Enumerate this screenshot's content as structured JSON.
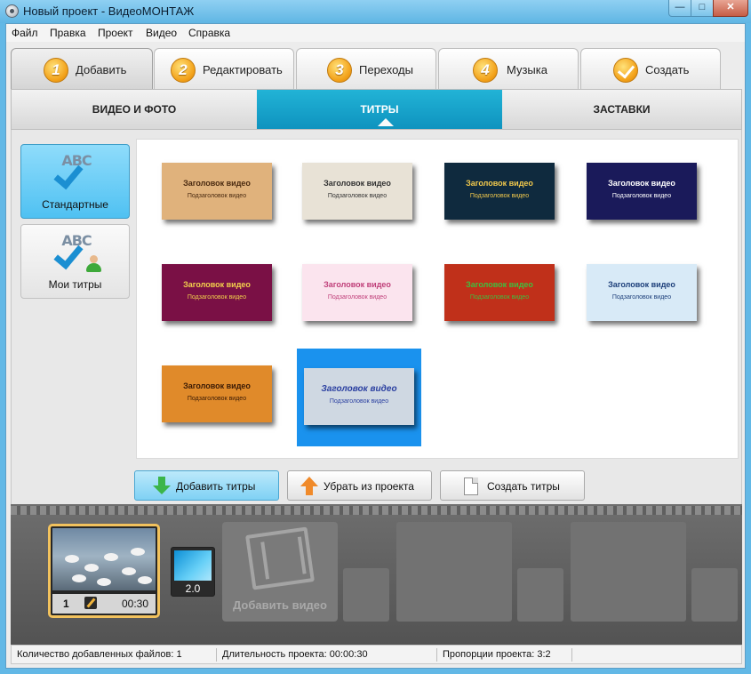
{
  "window": {
    "title": "Новый проект - ВидеоМОНТАЖ"
  },
  "menu": [
    "Файл",
    "Правка",
    "Проект",
    "Видео",
    "Справка"
  ],
  "tabs": [
    {
      "num": "1",
      "label": "Добавить"
    },
    {
      "num": "2",
      "label": "Редактировать"
    },
    {
      "num": "3",
      "label": "Переходы"
    },
    {
      "num": "4",
      "label": "Музыка"
    },
    {
      "num": "",
      "label": "Создать"
    }
  ],
  "subtabs": [
    "ВИДЕО И ФОТО",
    "ТИТРЫ",
    "ЗАСТАВКИ"
  ],
  "categories": [
    {
      "icon_text": "ABC",
      "label": "Стандартные"
    },
    {
      "icon_text": "ABC",
      "label": "Мои титры"
    }
  ],
  "thumbnails": [
    {
      "title": "Заголовок видео",
      "subtitle": "Подзаголовок видео",
      "bg": "#e0b27c",
      "color": "#4a2a10"
    },
    {
      "title": "Заголовок видео",
      "subtitle": "Подзаголовок видео",
      "bg": "#e8e2d6",
      "color": "#333333"
    },
    {
      "title": "Заголовок видео",
      "subtitle": "Подзаголовок видео",
      "bg": "#0f2a3e",
      "color": "#f2c94c"
    },
    {
      "title": "Заголовок видео",
      "subtitle": "Подзаголовок видео",
      "bg": "#1a1a5a",
      "color": "#ffffff"
    },
    {
      "title": "Заголовок видео",
      "subtitle": "Подзаголовок видео",
      "bg": "#7a1045",
      "color": "#f2d04c"
    },
    {
      "title": "Заголовок видео",
      "subtitle": "Подзаголовок видео",
      "bg": "#fbe4ee",
      "color": "#c0407a"
    },
    {
      "title": "Заголовок видео",
      "subtitle": "Подзаголовок видео",
      "bg": "#c0301a",
      "color": "#3fbf3f"
    },
    {
      "title": "Заголовок видео",
      "subtitle": "Подзаголовок видео",
      "bg": "#d8eaf7",
      "color": "#1d3f7a"
    },
    {
      "title": "Заголовок видео",
      "subtitle": "Подзаголовок видео",
      "bg": "#e08a2a",
      "color": "#3a1a05"
    },
    {
      "title": "Заголовок видео",
      "subtitle": "Подзаголовок видео",
      "bg": "#cfd8e2",
      "color": "#2a3fa0"
    }
  ],
  "actions": {
    "add": "Добавить титры",
    "remove": "Убрать из проекта",
    "create": "Создать титры"
  },
  "timeline": {
    "clip_number": "1",
    "clip_duration": "00:30",
    "transition_duration": "2.0",
    "add_video": "Добавить видео"
  },
  "status": {
    "files": "Количество добавленных файлов: 1",
    "duration": "Длительность проекта:  00:00:30",
    "ratio": "Пропорции проекта:  3:2"
  }
}
